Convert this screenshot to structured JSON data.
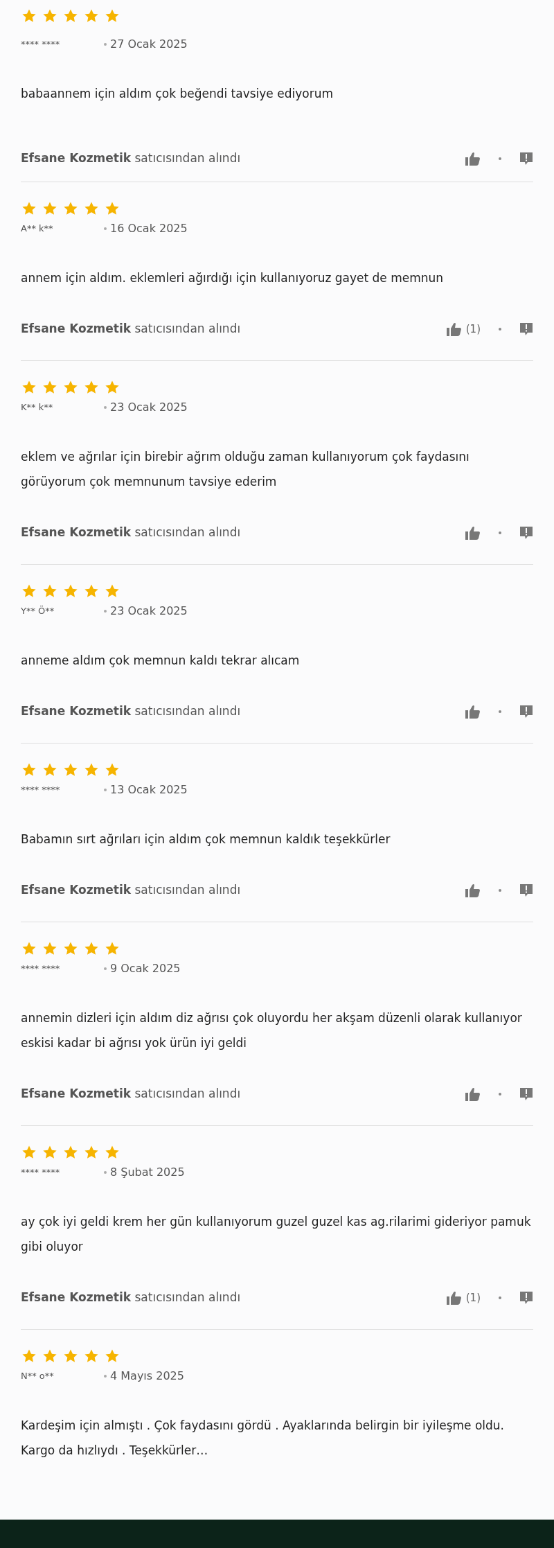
{
  "reviews": [
    {
      "stars": 5,
      "author": "**** ****",
      "date": "27 Ocak 2025",
      "text": "babaannem için aldım çok beğendi tavsiye ediyorum",
      "seller": "Efsane Kozmetik",
      "seller_suffix": "satıcısından alındı"
    },
    {
      "stars": 5,
      "author": "A** k**",
      "date": "16 Ocak 2025",
      "text": "annem için aldım. eklemleri ağırdığı için kullanıyoruz gayet de memnun",
      "seller": "Efsane Kozmetik",
      "seller_suffix": "satıcısından alındı",
      "like_count": "(1)"
    },
    {
      "stars": 5,
      "author": "K** k**",
      "date": "23 Ocak 2025",
      "text": "eklem ve ağrılar için birebir ağrım olduğu zaman kullanıyorum çok faydasını görüyorum çok memnunum tavsiye ederim",
      "seller": "Efsane Kozmetik",
      "seller_suffix": "satıcısından alındı"
    },
    {
      "stars": 5,
      "author": "Y** Ö**",
      "date": "23 Ocak 2025",
      "text": "anneme aldım çok memnun kaldı tekrar alıcam",
      "seller": "Efsane Kozmetik",
      "seller_suffix": "satıcısından alındı"
    },
    {
      "stars": 5,
      "author": "**** ****",
      "date": "13 Ocak 2025",
      "text": "Babamın sırt ağrıları için aldım çok memnun kaldık teşekkürler",
      "seller": "Efsane Kozmetik",
      "seller_suffix": "satıcısından alındı"
    },
    {
      "stars": 5,
      "author": "**** ****",
      "date": "9 Ocak 2025",
      "text": "annemin dizleri için aldım diz ağrısı çok oluyordu her akşam düzenli olarak kullanıyor eskisi kadar bi ağrısı yok ürün iyi geldi",
      "seller": "Efsane Kozmetik",
      "seller_suffix": "satıcısından alındı"
    },
    {
      "stars": 5,
      "author": "**** ****",
      "date": "8 Şubat 2025",
      "text": "ay çok iyi geldi krem her gün kullanıyorum guzel guzel kas ag.rilarimi gideriyor pamuk gibi oluyor",
      "seller": "Efsane Kozmetik",
      "seller_suffix": "satıcısından alındı",
      "like_count": "(1)"
    },
    {
      "stars": 5,
      "author": "N** o**",
      "date": "4 Mayıs 2025",
      "text": "Kardeşim için almıştı . Çok faydasını gördü . Ayaklarında belirgin bir iyileşme oldu. Kargo da hızlıydı . Teşekkürler…"
    }
  ]
}
